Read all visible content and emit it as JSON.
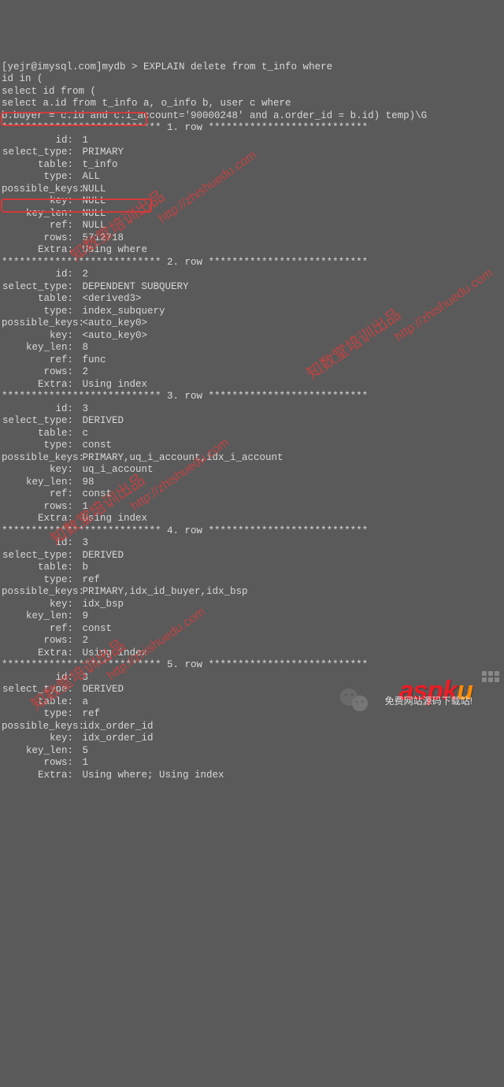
{
  "header": {
    "prompt": "[yejr@imysql.com]mydb > EXPLAIN delete from t_info where",
    "line2": "id in (",
    "line3": "select id from (",
    "line4": "select a.id from t_info a, o_info b, user c where",
    "line5": "b.buyer = c.id and c.i_account='90000248' and a.order_id = b.id) temp)\\G"
  },
  "rows": [
    {
      "sep": "*************************** 1. row ***************************",
      "fields": [
        {
          "k": "id",
          "v": "1"
        },
        {
          "k": "select_type",
          "v": "PRIMARY"
        },
        {
          "k": "table",
          "v": "t_info"
        },
        {
          "k": "type",
          "v": "ALL"
        },
        {
          "k": "possible_keys",
          "v": "NULL"
        },
        {
          "k": "key",
          "v": "NULL"
        },
        {
          "k": "key_len",
          "v": "NULL"
        },
        {
          "k": "ref",
          "v": "NULL"
        },
        {
          "k": "rows",
          "v": "5712718"
        },
        {
          "k": "Extra",
          "v": "Using where"
        }
      ]
    },
    {
      "sep": "*************************** 2. row ***************************",
      "fields": [
        {
          "k": "id",
          "v": "2"
        },
        {
          "k": "select_type",
          "v": "DEPENDENT SUBQUERY"
        },
        {
          "k": "table",
          "v": "<derived3>"
        },
        {
          "k": "type",
          "v": "index_subquery"
        },
        {
          "k": "possible_keys",
          "v": "<auto_key0>"
        },
        {
          "k": "key",
          "v": "<auto_key0>"
        },
        {
          "k": "key_len",
          "v": "8"
        },
        {
          "k": "ref",
          "v": "func"
        },
        {
          "k": "rows",
          "v": "2"
        },
        {
          "k": "Extra",
          "v": "Using index"
        }
      ]
    },
    {
      "sep": "*************************** 3. row ***************************",
      "fields": [
        {
          "k": "id",
          "v": "3"
        },
        {
          "k": "select_type",
          "v": "DERIVED"
        },
        {
          "k": "table",
          "v": "c"
        },
        {
          "k": "type",
          "v": "const"
        },
        {
          "k": "possible_keys",
          "v": "PRIMARY,uq_i_account,idx_i_account"
        },
        {
          "k": "key",
          "v": "uq_i_account"
        },
        {
          "k": "key_len",
          "v": "98"
        },
        {
          "k": "ref",
          "v": "const"
        },
        {
          "k": "rows",
          "v": "1"
        },
        {
          "k": "Extra",
          "v": "Using index"
        }
      ]
    },
    {
      "sep": "*************************** 4. row ***************************",
      "fields": [
        {
          "k": "id",
          "v": "3"
        },
        {
          "k": "select_type",
          "v": "DERIVED"
        },
        {
          "k": "table",
          "v": "b"
        },
        {
          "k": "type",
          "v": "ref"
        },
        {
          "k": "possible_keys",
          "v": "PRIMARY,idx_id_buyer,idx_bsp"
        },
        {
          "k": "key",
          "v": "idx_bsp"
        },
        {
          "k": "key_len",
          "v": "9"
        },
        {
          "k": "ref",
          "v": "const"
        },
        {
          "k": "rows",
          "v": "2"
        },
        {
          "k": "Extra",
          "v": "Using index"
        }
      ]
    },
    {
      "sep": "*************************** 5. row ***************************",
      "fields": [
        {
          "k": "id",
          "v": "3"
        },
        {
          "k": "select_type",
          "v": "DERIVED"
        },
        {
          "k": "table",
          "v": "a"
        },
        {
          "k": "type",
          "v": "ref"
        },
        {
          "k": "possible_keys",
          "v": "idx_order_id"
        },
        {
          "k": "key",
          "v": "idx_order_id"
        },
        {
          "k": "key_len",
          "v": "5"
        },
        {
          "k": "rows",
          "v": "1"
        },
        {
          "k": "Extra",
          "v": "Using where; Using index"
        }
      ]
    }
  ],
  "watermarks": {
    "cn": "知数堂培训出品",
    "url": "http://zhishuedu.com"
  },
  "footer": {
    "logo_a": "aspk",
    "logo_b": "u",
    "text": "免费网站源码下载站!"
  }
}
